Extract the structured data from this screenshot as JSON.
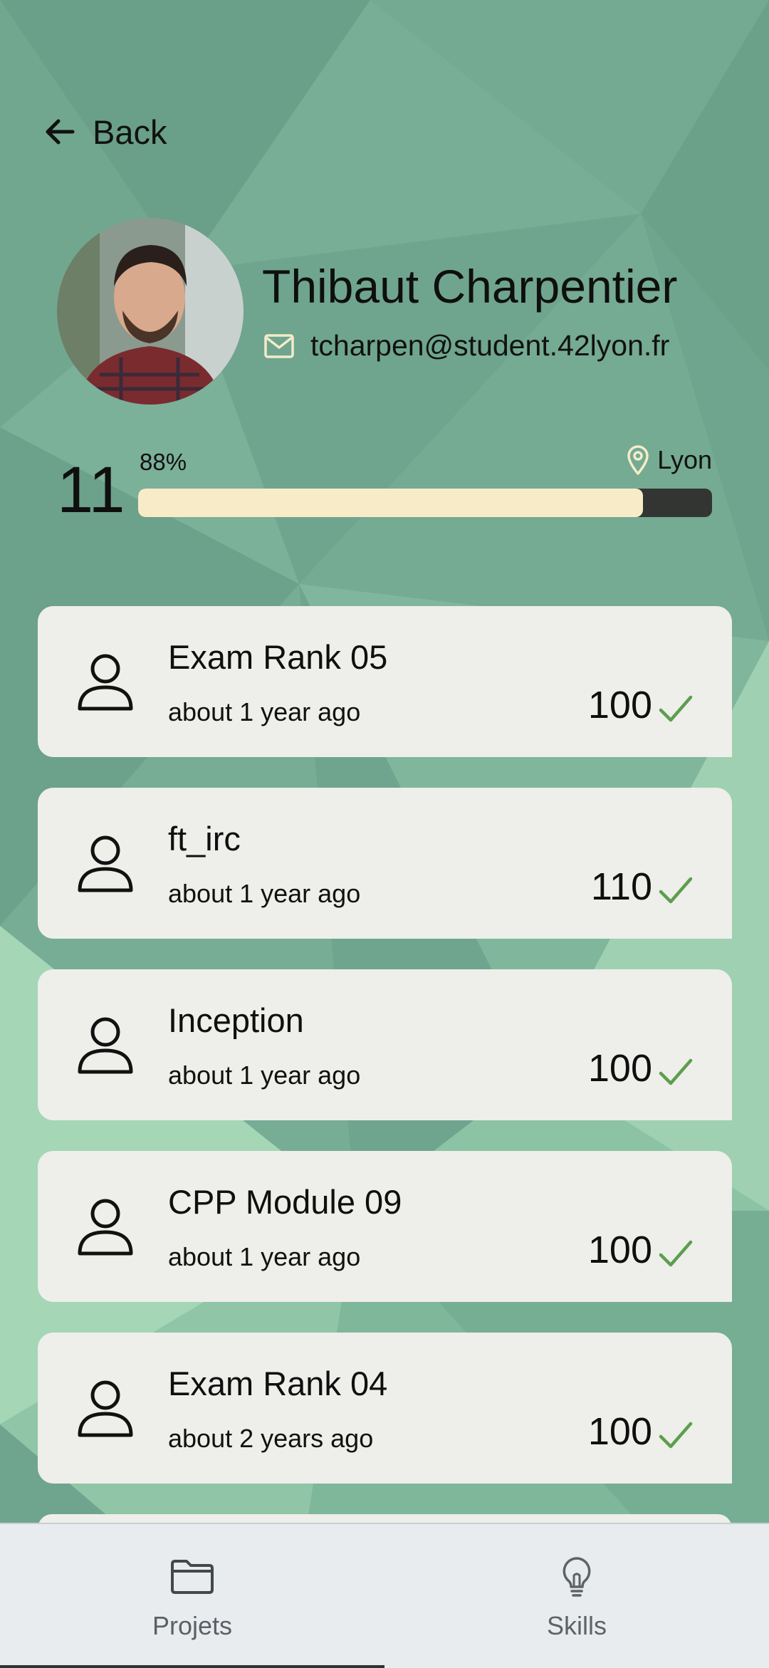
{
  "header": {
    "back_label": "Back"
  },
  "profile": {
    "name": "Thibaut Charpentier",
    "email": "tcharpen@student.42lyon.fr",
    "level": "11",
    "level_percent_label": "88%",
    "level_progress": 0.88,
    "location": "Lyon"
  },
  "projects": [
    {
      "title": "Exam Rank 05",
      "time": "about 1 year ago",
      "score": "100",
      "status": "validated"
    },
    {
      "title": "ft_irc",
      "time": "about 1 year ago",
      "score": "110",
      "status": "validated"
    },
    {
      "title": "Inception",
      "time": "about 1 year ago",
      "score": "100",
      "status": "validated"
    },
    {
      "title": "CPP Module 09",
      "time": "about 1 year ago",
      "score": "100",
      "status": "validated"
    },
    {
      "title": "Exam Rank 04",
      "time": "about 2 years ago",
      "score": "100",
      "status": "validated"
    }
  ],
  "bottom_nav": {
    "items": [
      {
        "label": "Projets",
        "icon": "folder-icon",
        "active": true
      },
      {
        "label": "Skills",
        "icon": "lightbulb-icon",
        "active": false
      }
    ]
  },
  "colors": {
    "background": "#6fa58f",
    "card": "#eeeeea",
    "progress_fill": "#f8ecc8",
    "progress_track": "#333532",
    "check": "#5c9e4e",
    "nav_background": "#e9ecee"
  }
}
